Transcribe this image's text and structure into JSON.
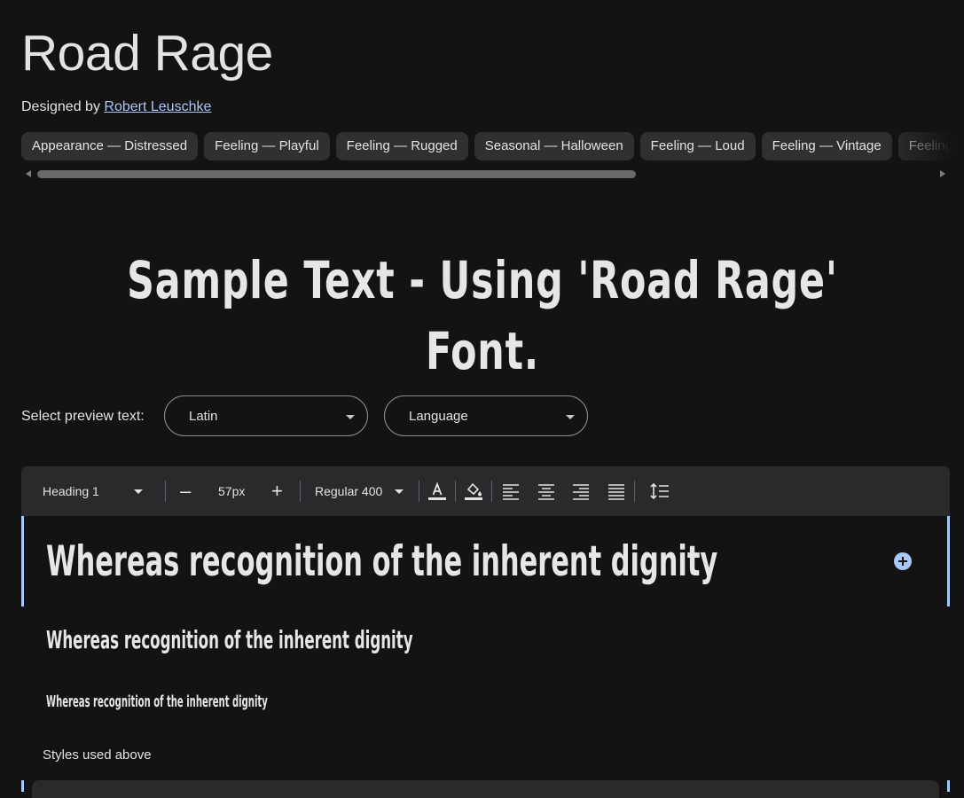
{
  "font": {
    "title": "Road Rage",
    "designed_by_label": "Designed by",
    "designer": "Robert Leuschke"
  },
  "tags": [
    "Appearance — Distressed",
    "Feeling — Playful",
    "Feeling — Rugged",
    "Seasonal — Halloween",
    "Feeling — Loud",
    "Feeling — Vintage",
    "Feeling"
  ],
  "sample_text": "Sample Text - Using 'Road Rage' Font.",
  "preview_controls": {
    "label": "Select preview text:",
    "script_value": "Latin",
    "language_value": "Language"
  },
  "toolbar": {
    "style": "Heading 1",
    "size": "57px",
    "weight": "Regular 400",
    "decrease_symbol": "–",
    "increase_symbol": "+"
  },
  "preview_lines": [
    "Whereas recognition of the inherent dignity",
    "Whereas recognition of the inherent dignity",
    "Whereas recognition of the inherent dignity"
  ],
  "styles_used_label": "Styles used above",
  "colors": {
    "background": "#131314",
    "chip": "#303030",
    "toolbar": "#292a2b",
    "accent": "#a8c7fa"
  }
}
